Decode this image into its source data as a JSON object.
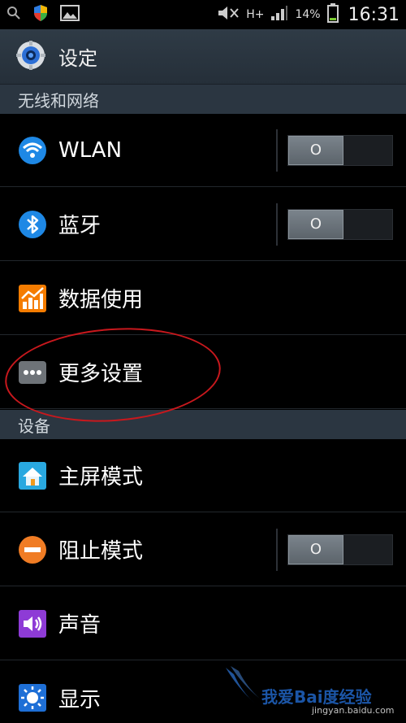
{
  "status_bar": {
    "battery_percent": "14%",
    "network_type": "H+",
    "time": "16:31",
    "left_icons": [
      "search-icon",
      "shield-icon",
      "image-icon"
    ],
    "right_icons": [
      "mute-icon",
      "network-icon",
      "signal-icon",
      "battery-icon"
    ]
  },
  "header": {
    "title": "设定",
    "icon": "settings-gear-icon"
  },
  "sections": [
    {
      "title": "无线和网络",
      "items": [
        {
          "label": "WLAN",
          "icon": "wifi-icon",
          "toggle": {
            "state": "off"
          }
        },
        {
          "label": "蓝牙",
          "icon": "bluetooth-icon",
          "toggle": {
            "state": "off"
          }
        },
        {
          "label": "数据使用",
          "icon": "data-usage-icon"
        },
        {
          "label": "更多设置",
          "icon": "more-icon"
        }
      ]
    },
    {
      "title": "设备",
      "items": [
        {
          "label": "主屏模式",
          "icon": "home-icon"
        },
        {
          "label": "阻止模式",
          "icon": "block-icon",
          "toggle": {
            "state": "off"
          }
        },
        {
          "label": "声音",
          "icon": "sound-icon"
        },
        {
          "label": "显示",
          "icon": "display-icon"
        }
      ]
    }
  ],
  "toggle_symbol": "O",
  "watermark": {
    "text": "我爱Bai度经验",
    "url": "jingyan.baidu.com"
  },
  "colors": {
    "section_bg": "#2b3641",
    "annotation": "#c8181d",
    "wifi_blue": "#1e88e5",
    "data_orange": "#f57c00"
  }
}
